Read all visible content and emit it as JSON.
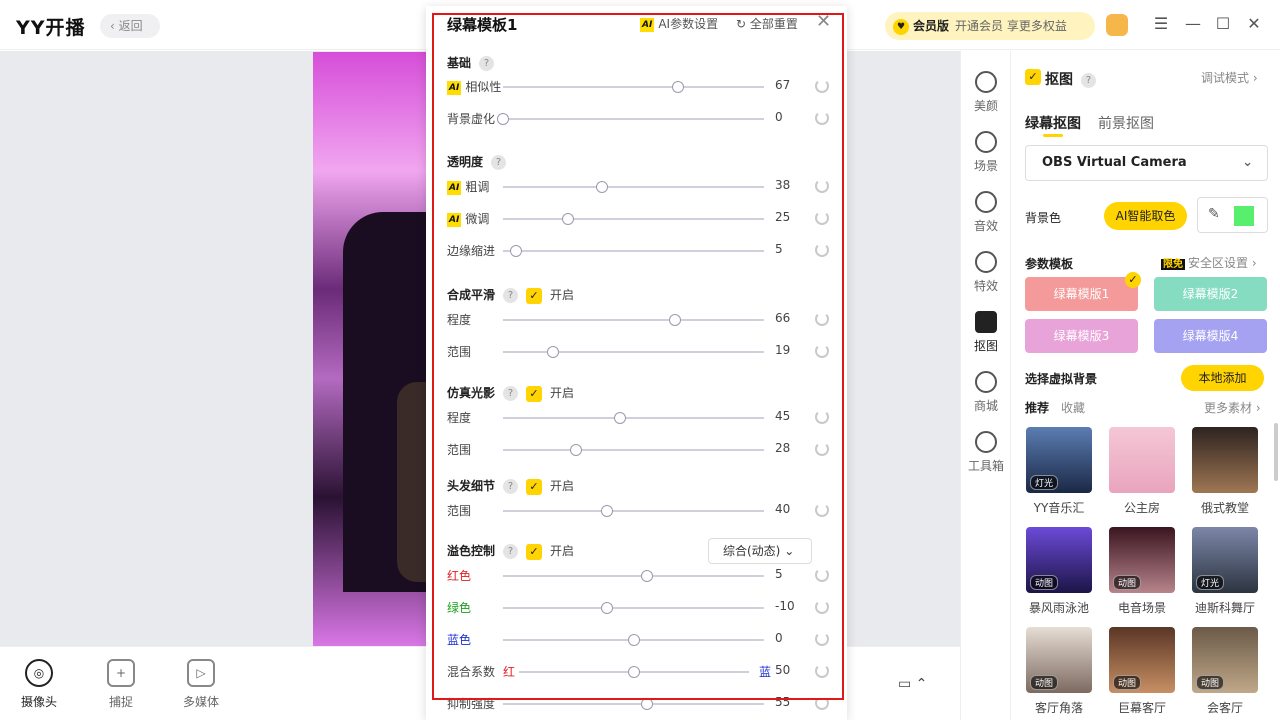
{
  "app": {
    "logo": "YY开播",
    "back": "返回"
  },
  "vip": {
    "label": "会员版",
    "promo": "开通会员 享更多权益"
  },
  "window": {
    "menu": "☰",
    "min": "—",
    "max": "☐",
    "close": "✕"
  },
  "bottom": {
    "camera": "摄像头",
    "capture": "捕捉",
    "media": "多媒体"
  },
  "modal": {
    "title": "绿幕模板1",
    "ai_settings": "AI参数设置",
    "reset_all": "全部重置",
    "on_label": "开启",
    "sections": {
      "basic": "基础",
      "alpha": "透明度",
      "smooth": "合成平滑",
      "light": "仿真光影",
      "hair": "头发细节",
      "spill": "溢色控制"
    },
    "ai_badge": "AI",
    "rows": {
      "similarity": {
        "label": "相似性",
        "value": 67
      },
      "blur": {
        "label": "背景虚化",
        "value": 0
      },
      "coarse": {
        "label": "粗调",
        "value": 38
      },
      "fine": {
        "label": "微调",
        "value": 25
      },
      "edge": {
        "label": "边缘缩进",
        "value": 5
      },
      "smooth_degree": {
        "label": "程度",
        "value": 66
      },
      "smooth_range": {
        "label": "范围",
        "value": 19
      },
      "light_degree": {
        "label": "程度",
        "value": 45
      },
      "light_range": {
        "label": "范围",
        "value": 28
      },
      "hair_range": {
        "label": "范围",
        "value": 40
      },
      "red": {
        "label": "红色",
        "value": 5
      },
      "green": {
        "label": "绿色",
        "value": -10
      },
      "blue": {
        "label": "蓝色",
        "value": 0
      },
      "mix": {
        "label": "混合系数",
        "left": "红",
        "right": "蓝",
        "value": 50
      },
      "suppress": {
        "label": "抑制强度",
        "value": 55
      }
    },
    "spill_mode": "综合(动态)"
  },
  "nav": [
    {
      "label": "美颜",
      "icon": "smile-icon"
    },
    {
      "label": "场景",
      "icon": "layers-icon"
    },
    {
      "label": "音效",
      "icon": "sound-icon"
    },
    {
      "label": "特效",
      "icon": "sparkle-icon"
    },
    {
      "label": "抠图",
      "icon": "cutout-icon"
    },
    {
      "label": "商城",
      "icon": "shop-icon"
    },
    {
      "label": "工具箱",
      "icon": "toolbox-icon"
    }
  ],
  "panel": {
    "title": "抠图",
    "debug": "调试模式",
    "tab_green": "绿幕抠图",
    "tab_fg": "前景抠图",
    "camera": "OBS Virtual Camera",
    "bg_color": "背景色",
    "ai_pick": "AI智能取色",
    "pick_color": "#58ef6e",
    "templates_label": "参数模板",
    "limit_tag": "限免",
    "safe_zone": "安全区设置",
    "templates": [
      "绿幕模版1",
      "绿幕模版2",
      "绿幕模版3",
      "绿幕模版4"
    ],
    "select_bg": "选择虚拟背景",
    "local_add": "本地添加",
    "recommend": "推荐",
    "favorite": "收藏",
    "more": "更多素材",
    "backgrounds": [
      {
        "name": "YY音乐汇",
        "badge": "灯光"
      },
      {
        "name": "公主房",
        "badge": ""
      },
      {
        "name": "俄式教堂",
        "badge": ""
      },
      {
        "name": "暴风雨泳池",
        "badge": "动图"
      },
      {
        "name": "电音场景",
        "badge": "动图"
      },
      {
        "name": "迪斯科舞厅",
        "badge": "灯光"
      },
      {
        "name": "客厅角落",
        "badge": "动图"
      },
      {
        "name": "巨幕客厅",
        "badge": "动图"
      },
      {
        "name": "会客厅",
        "badge": "动图"
      }
    ]
  }
}
